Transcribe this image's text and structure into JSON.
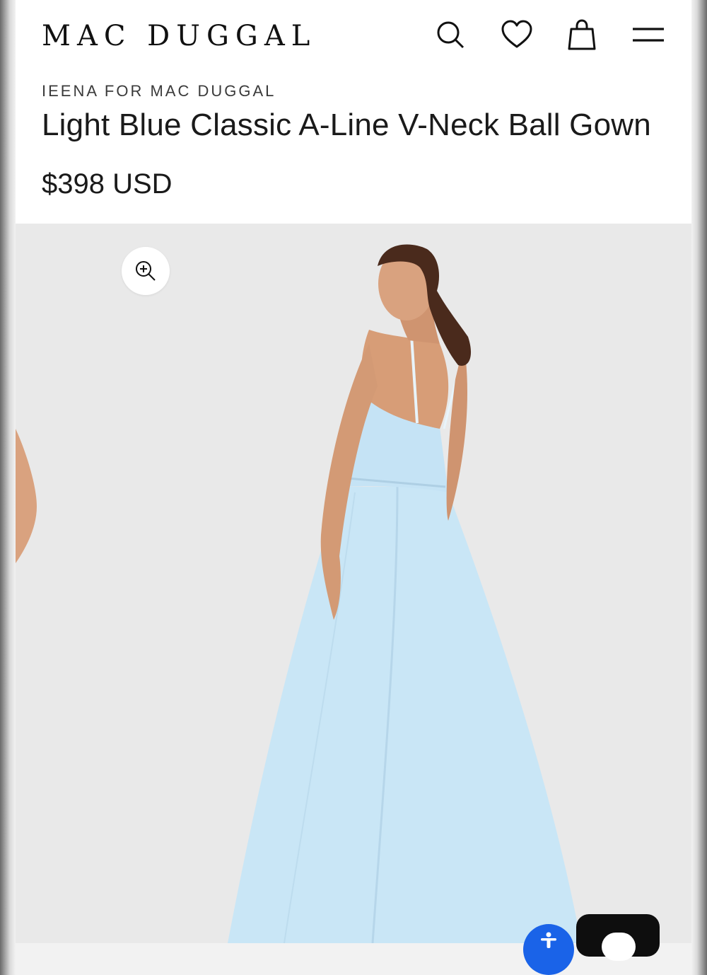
{
  "header": {
    "logo": "MAC DUGGAL",
    "icons": [
      "search-icon",
      "heart-icon",
      "shopping-bag-icon",
      "menu-icon"
    ]
  },
  "product": {
    "designer": "IEENA FOR MAC DUGGAL",
    "title": "Light Blue Classic A-Line V-Neck Ball Gown",
    "price": "$398 USD"
  },
  "gallery": {
    "zoom_icon": "zoom-in-icon",
    "background_color": "#e9e9e9",
    "gown_color": "#c9e6f6"
  },
  "floating": {
    "accessibility_icon": "accessibility-icon",
    "accessibility_color": "#1a63e8",
    "chat_icon": "chat-icon"
  }
}
